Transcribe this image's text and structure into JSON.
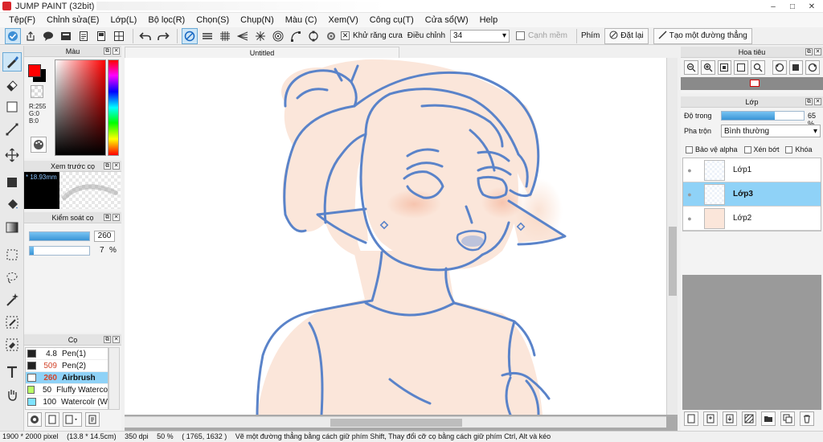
{
  "window": {
    "title": "JUMP PAINT (32bit)",
    "controls": [
      "–",
      "□",
      "✕"
    ]
  },
  "menu": [
    "Tệp(F)",
    "Chỉnh sửa(E)",
    "Lớp(L)",
    "Bộ lọc(R)",
    "Chọn(S)",
    "Chụp(N)",
    "Màu (C)",
    "Xem(V)",
    "Công cụ(T)",
    "Cửa sổ(W)",
    "Help"
  ],
  "toolbar": {
    "antialias_label": "Khử răng cưa",
    "adjust_label": "Điều chỉnh",
    "adjust_value": "34",
    "smooth_label": "Cạnh mềm",
    "key_label": "Phím",
    "reset_label": "Đặt lại",
    "line_label": "Tạo một đường thẳng"
  },
  "panels": {
    "color": {
      "title": "Màu",
      "r": "R:255",
      "g": "G:0",
      "b": "B:0",
      "fg": "#ff0000",
      "bg": "#000000"
    },
    "preview": {
      "title": "Xem trước cọ",
      "size": "18.93mm"
    },
    "brush_control": {
      "title": "Kiểm soát cọ",
      "size_value": "260",
      "density_value": "7",
      "density_unit": "%",
      "size_fill_fraction": 1.0,
      "density_fill_fraction": 0.07
    },
    "brush": {
      "title": "Cọ",
      "items": [
        {
          "size": "4.8",
          "name": "Pen(1)",
          "color": "#222222"
        },
        {
          "size": "509",
          "name": "Pen(2)",
          "color": "#222222"
        },
        {
          "size": "260",
          "name": "Airbrush",
          "color": "#ffffff"
        },
        {
          "size": "50",
          "name": "Fluffy Waterco",
          "color": "#b9ff66"
        },
        {
          "size": "100",
          "name": "Watercolr (W",
          "color": "#7fe3ff"
        }
      ]
    },
    "navigator": {
      "title": "Hoa tiêu"
    },
    "layers": {
      "title": "Lớp",
      "opacity_label": "Độ trong",
      "opacity_value": "65 %",
      "opacity_fraction": 0.65,
      "blend_label": "Pha trộn",
      "blend_value": "Bình thường",
      "protect_alpha": "Bảo vệ alpha",
      "clip": "Xén bớt",
      "lock": "Khóa",
      "items": [
        {
          "name": "Lớp1",
          "selected": false
        },
        {
          "name": "Lớp3",
          "selected": true
        },
        {
          "name": "Lớp2",
          "selected": false
        }
      ]
    }
  },
  "canvas": {
    "tab_title": "Untitled"
  },
  "status": {
    "size": "1900 * 2000 pixel",
    "cm": "(13.8 * 14.5cm)",
    "dpi": "350 dpi",
    "zoom": "50 %",
    "coords": "( 1765, 1632 )",
    "hint": "Vẽ một đường thẳng bằng cách giữ phím Shift, Thay đổi cỡ cọ bằng cách giữ phím Ctrl, Alt và kéo"
  },
  "colors": {
    "accent": "#8fd2f7",
    "stroke": "#5a83c9",
    "skin": "#fbe6da"
  },
  "icons": [
    "brush-icon",
    "eraser-icon",
    "selection-icon",
    "line-icon",
    "move-icon",
    "fill-icon",
    "bucket-icon",
    "gradient-icon",
    "marquee-icon",
    "lasso-icon",
    "magic-wand-icon",
    "eyedropper-icon",
    "text-icon",
    "hand-icon"
  ]
}
